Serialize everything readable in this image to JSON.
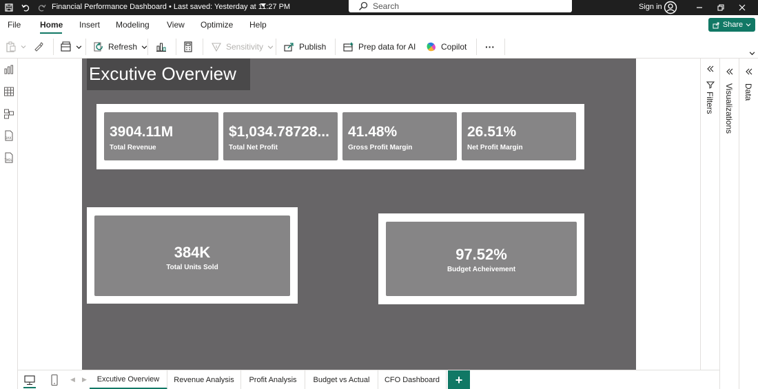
{
  "titlebar": {
    "document_title": "Financial Performance Dashboard • Last saved: Yesterday at 11:27 PM",
    "search_placeholder": "Search",
    "sign_in": "Sign in"
  },
  "menu": {
    "items": [
      "File",
      "Home",
      "Insert",
      "Modeling",
      "View",
      "Optimize",
      "Help"
    ],
    "active": "Home",
    "share_label": "Share"
  },
  "ribbon": {
    "refresh": "Refresh",
    "sensitivity": "Sensitivity",
    "publish": "Publish",
    "prep_data": "Prep data for AI",
    "copilot": "Copilot",
    "more": "···"
  },
  "report": {
    "page_title": "Excutive Overview",
    "kpis": [
      {
        "value": "3904.11M",
        "label": "Total Revenue"
      },
      {
        "value": "$1,034.78728...",
        "label": "Total Net Profit"
      },
      {
        "value": "41.48%",
        "label": "Gross Profit Margin"
      },
      {
        "value": "26.51%",
        "label": "Net Profit Margin"
      }
    ],
    "units_sold": {
      "value": "384K",
      "label": "Total Units Sold"
    },
    "budget": {
      "value": "97.52%",
      "label": "Budget Acheivement"
    }
  },
  "panes": {
    "filters": "Filters",
    "visualizations": "Visualizations",
    "data": "Data"
  },
  "tabs": [
    "Excutive Overview",
    "Revenue Analysis",
    "Profit Analysis",
    "Budget vs Actual",
    "CFO Dashboard"
  ],
  "add_tab": "+",
  "colors": {
    "accent": "#117865",
    "page_bg": "#676567",
    "card_bg": "#868586",
    "title_box": "#4a494a"
  }
}
